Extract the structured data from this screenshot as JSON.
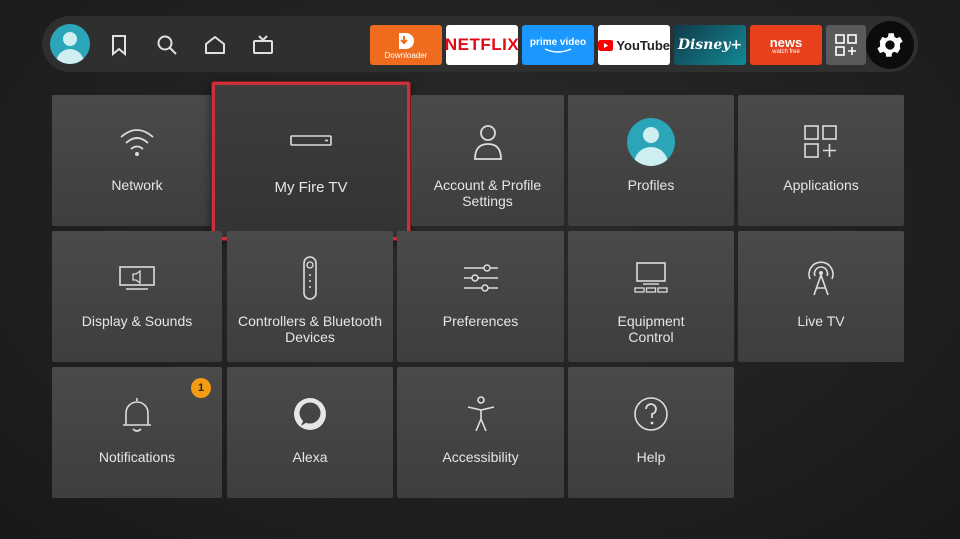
{
  "topbar": {
    "profile_icon": "profile-avatar",
    "nav": [
      {
        "icon": "bookmark-icon"
      },
      {
        "icon": "search-icon"
      },
      {
        "icon": "home-icon"
      },
      {
        "icon": "live-tv-icon"
      }
    ],
    "apps": [
      {
        "name": "Downloader",
        "bg": "#ef6b1d"
      },
      {
        "name": "NETFLIX",
        "bg": "#ffffff",
        "color": "#e50914"
      },
      {
        "name": "prime video",
        "bg": "#1a98ff",
        "color": "#ffffff"
      },
      {
        "name": "YouTube",
        "bg": "#ffffff",
        "color": "#222222"
      },
      {
        "name": "Disney+",
        "bg": "#0d5b6b",
        "color": "#ffffff"
      },
      {
        "name": "news",
        "sub": "watch free",
        "bg": "#e8401a",
        "color": "#ffffff"
      }
    ],
    "apps_icon": "apps-grid-icon",
    "settings_icon": "gear-icon"
  },
  "tiles": {
    "network": "Network",
    "my_fire_tv": "My Fire TV",
    "account_line1": "Account & Profile",
    "account_line2": "Settings",
    "profiles": "Profiles",
    "applications": "Applications",
    "display": "Display & Sounds",
    "controllers_line1": "Controllers & Bluetooth",
    "controllers_line2": "Devices",
    "preferences": "Preferences",
    "equipment_line1": "Equipment",
    "equipment_line2": "Control",
    "live_tv": "Live TV",
    "notifications": "Notifications",
    "notifications_badge": "1",
    "alexa": "Alexa",
    "accessibility": "Accessibility",
    "help": "Help"
  },
  "colors": {
    "focus_border": "#c8303a",
    "badge": "#f39c12",
    "tile_bg": "#454545"
  }
}
